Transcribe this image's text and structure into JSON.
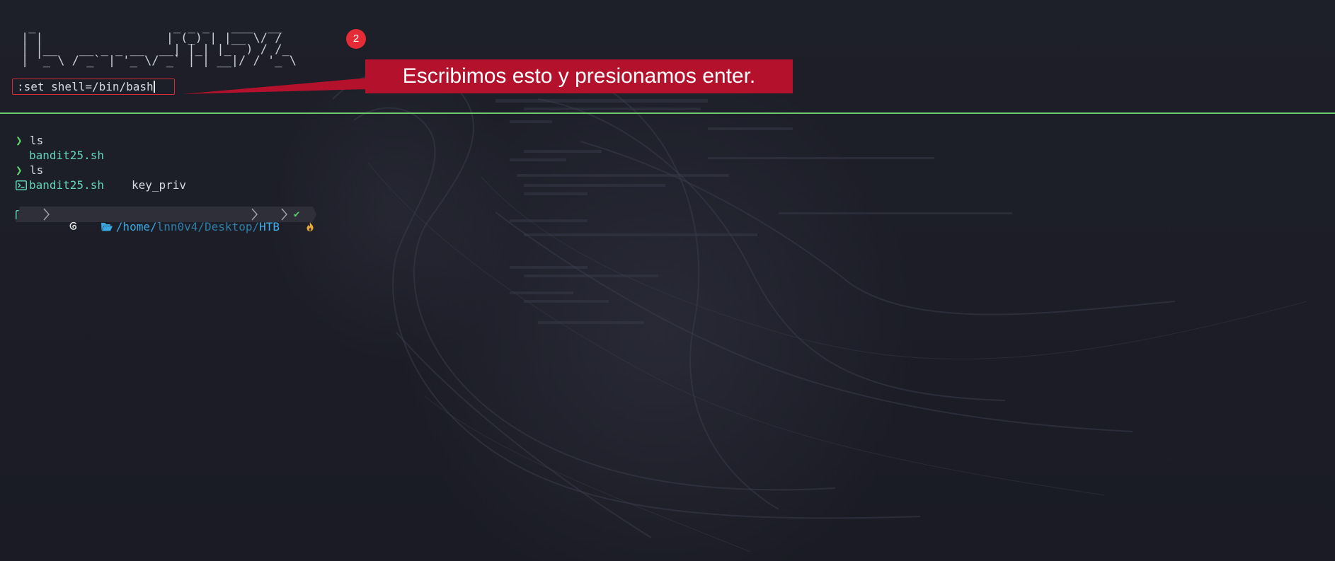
{
  "editor": {
    "ascii_banner": [
      " _                   _ _ _   ___  __ ",
      "| |                 | (_) | |__ \\/ / ",
      "| |__   __ _ _ __  __| |_| |_  ) / /_ ",
      "| '_ \\ / _` | '_ \\/ _` | | __|/ / '_ \\"
    ],
    "command_line": ":set shell=/bin/bash"
  },
  "annotation": {
    "step_number": "2",
    "callout_text": "Escribimos esto y presionamos enter.",
    "color": "#b4112d"
  },
  "terminal": {
    "lines": [
      {
        "prompt": "❯",
        "command": "ls"
      },
      {
        "files": [
          "bandit25.sh"
        ]
      },
      {
        "prompt": "❯",
        "command": "ls"
      },
      {
        "files": [
          "bandit25.sh",
          "key_priv"
        ]
      }
    ],
    "prompt_bar": {
      "os_icon": "debian-swirl-icon",
      "path_prefix": "/home/",
      "path_user": "lnn0v4",
      "path_mid": "/Desktop/",
      "path_last": "HTB",
      "status_icon": "flame-icon",
      "status_ok": "✔"
    }
  },
  "colors": {
    "background": "#1b1c25",
    "prompt_arrow": "#5cd36b",
    "exec_file": "#63d3bb",
    "path": "#3aa7e0",
    "divider": "#6fc96f"
  }
}
